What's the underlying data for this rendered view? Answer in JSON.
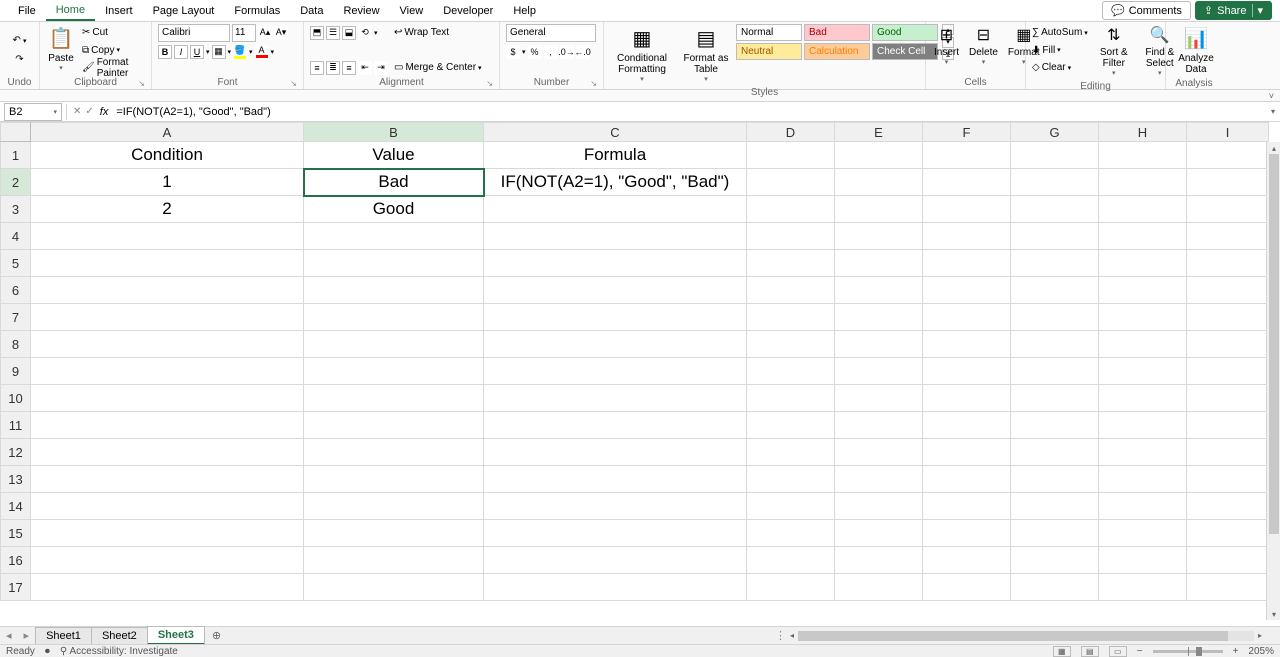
{
  "menu": {
    "tabs": [
      "File",
      "Home",
      "Insert",
      "Page Layout",
      "Formulas",
      "Data",
      "Review",
      "View",
      "Developer",
      "Help"
    ],
    "active": "Home",
    "comments": "Comments",
    "share": "Share"
  },
  "ribbon": {
    "undo_label": "Undo",
    "clipboard": {
      "paste": "Paste",
      "cut": "Cut",
      "copy": "Copy",
      "format_painter": "Format Painter",
      "label": "Clipboard"
    },
    "font": {
      "name": "Calibri",
      "size": "11",
      "bold": "B",
      "italic": "I",
      "underline": "U",
      "label": "Font"
    },
    "alignment": {
      "wrap": "Wrap Text",
      "merge": "Merge & Center",
      "label": "Alignment"
    },
    "number": {
      "format": "General",
      "label": "Number"
    },
    "styles": {
      "cond": "Conditional Formatting",
      "table": "Format as Table",
      "normal": "Normal",
      "bad": "Bad",
      "good": "Good",
      "neutral": "Neutral",
      "calc": "Calculation",
      "check": "Check Cell",
      "label": "Styles"
    },
    "cells": {
      "insert": "Insert",
      "delete": "Delete",
      "format": "Format",
      "label": "Cells"
    },
    "editing": {
      "autosum": "AutoSum",
      "fill": "Fill",
      "clear": "Clear",
      "sort": "Sort & Filter",
      "find": "Find & Select",
      "label": "Editing"
    },
    "analysis": {
      "analyze": "Analyze Data",
      "label": "Analysis"
    }
  },
  "namebox": "B2",
  "formula": "=IF(NOT(A2=1), \"Good\", \"Bad\")",
  "columns": [
    "A",
    "B",
    "C",
    "D",
    "E",
    "F",
    "G",
    "H",
    "I"
  ],
  "rows": [
    "1",
    "2",
    "3",
    "4",
    "5",
    "6",
    "7",
    "8",
    "9",
    "10",
    "11",
    "12",
    "13",
    "14",
    "15",
    "16",
    "17"
  ],
  "cells": {
    "A1": "Condition",
    "B1": "Value",
    "C1": "Formula",
    "A2": "1",
    "B2": "Bad",
    "C2": "IF(NOT(A2=1), \"Good\", \"Bad\")",
    "A3": "2",
    "B3": "Good"
  },
  "selected_cell": "B2",
  "sheets": {
    "list": [
      "Sheet1",
      "Sheet2",
      "Sheet3"
    ],
    "active": "Sheet3"
  },
  "status": {
    "ready": "Ready",
    "accessibility": "Accessibility: Investigate",
    "zoom": "205%"
  },
  "chart_data": {
    "type": "table",
    "columns": [
      "Condition",
      "Value",
      "Formula"
    ],
    "rows": [
      [
        "1",
        "Bad",
        "IF(NOT(A2=1), \"Good\", \"Bad\")"
      ],
      [
        "2",
        "Good",
        ""
      ]
    ]
  }
}
